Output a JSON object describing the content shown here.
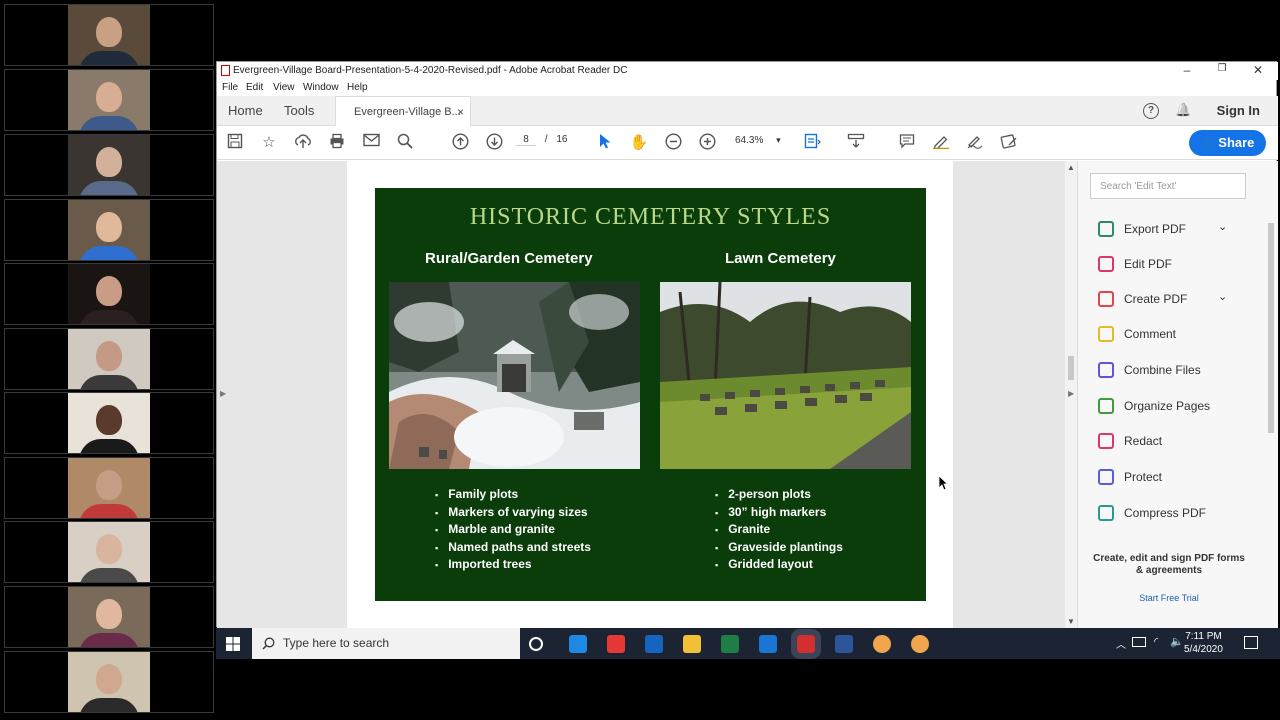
{
  "window": {
    "title": "Evergreen-Village Board-Presentation-5-4-2020-Revised.pdf - Adobe Acrobat Reader DC",
    "minimize": "–",
    "restore": "❐",
    "close": "✕"
  },
  "menu": [
    "File",
    "Edit",
    "View",
    "Window",
    "Help"
  ],
  "tabs": {
    "home": "Home",
    "tools": "Tools",
    "doc": "Evergreen-Village B...",
    "close": "×"
  },
  "header": {
    "help_icon": "?",
    "bell_icon": "🔔",
    "sign_in": "Sign In"
  },
  "toolbar": {
    "current_page": "8",
    "separator": "/",
    "total_pages": "16",
    "zoom": "64.3%",
    "zoom_arrow": "▾",
    "share": "Share"
  },
  "slide": {
    "title": "HISTORIC CEMETERY STYLES",
    "left_heading": "Rural/Garden Cemetery",
    "right_heading": "Lawn Cemetery",
    "left_bullets": [
      "Family plots",
      "Markers of varying sizes",
      "Marble and granite",
      "Named paths and streets",
      "Imported trees"
    ],
    "right_bullets": [
      "2-person plots",
      "30” high markers",
      "Granite",
      "Graveside plantings",
      "Gridded layout"
    ]
  },
  "right_panel": {
    "search_placeholder": "Search 'Edit Text'",
    "tools": [
      {
        "label": "Export PDF",
        "icon": "export-pdf-icon",
        "color": "#2b8a6e",
        "has_chevron": true
      },
      {
        "label": "Edit PDF",
        "icon": "edit-pdf-icon",
        "color": "#d9376e",
        "has_chevron": false
      },
      {
        "label": "Create PDF",
        "icon": "create-pdf-icon",
        "color": "#e0464b",
        "has_chevron": true
      },
      {
        "label": "Comment",
        "icon": "comment-icon",
        "color": "#e8b923",
        "has_chevron": false
      },
      {
        "label": "Combine Files",
        "icon": "combine-files-icon",
        "color": "#6b4fd8",
        "has_chevron": false
      },
      {
        "label": "Organize Pages",
        "icon": "organize-pages-icon",
        "color": "#3e9b3e",
        "has_chevron": false
      },
      {
        "label": "Redact",
        "icon": "redact-icon",
        "color": "#d9376e",
        "has_chevron": false
      },
      {
        "label": "Protect",
        "icon": "protect-icon",
        "color": "#5b5be0",
        "has_chevron": false
      },
      {
        "label": "Compress PDF",
        "icon": "compress-pdf-icon",
        "color": "#2b9a8e",
        "has_chevron": false
      }
    ],
    "chevron": "⌄",
    "promo": "Create, edit and sign PDF forms & agreements",
    "trial": "Start Free Trial"
  },
  "taskbar": {
    "search_placeholder": "Type here to search",
    "time": "7:11 PM",
    "date": "5/4/2020",
    "apps": [
      {
        "icon": "cortana-icon",
        "color": "#ffffff"
      },
      {
        "icon": "edge-icon",
        "color": "#1e88e5"
      },
      {
        "icon": "chrome-icon",
        "color": "#e53935"
      },
      {
        "icon": "outlook-icon",
        "color": "#1565c0"
      },
      {
        "icon": "file-explorer-icon",
        "color": "#f2c037"
      },
      {
        "icon": "excel-icon",
        "color": "#1e7e45"
      },
      {
        "icon": "outlook-2-icon",
        "color": "#1976d2"
      },
      {
        "icon": "acrobat-icon",
        "color": "#d32f2f"
      },
      {
        "icon": "word-icon",
        "color": "#2b579a"
      },
      {
        "icon": "app-orange-1-icon",
        "color": "#f0a44b"
      },
      {
        "icon": "app-orange-2-icon",
        "color": "#f0a44b"
      }
    ]
  },
  "participants": [
    {
      "bg": "#5a4a3a",
      "skin": "#c9a084",
      "shirt": "#1f2a3a"
    },
    {
      "bg": "#8a7a6a",
      "skin": "#d7ad94",
      "shirt": "#3e5a8a"
    },
    {
      "bg": "#3a3530",
      "skin": "#d3b09a",
      "shirt": "#5a6a8a"
    },
    {
      "bg": "#6a5a4a",
      "skin": "#e0b89a",
      "shirt": "#2f6fd0"
    },
    {
      "bg": "#1a1512",
      "skin": "#c99c86",
      "shirt": "#2a2020"
    },
    {
      "bg": "#cfc9c0",
      "skin": "#c49a86",
      "shirt": "#3a3a3a"
    },
    {
      "bg": "#e8e2d8",
      "skin": "#5a3a2a",
      "shirt": "#1a1a1a"
    },
    {
      "bg": "#b08a68",
      "skin": "#c49d84",
      "shirt": "#c03a3a"
    },
    {
      "bg": "#d8d0c4",
      "skin": "#d9b49e",
      "shirt": "#4a4a4a"
    },
    {
      "bg": "#7a6a5a",
      "skin": "#e0b8a0",
      "shirt": "#6a2a4a"
    },
    {
      "bg": "#cfc4b0",
      "skin": "#d0a890",
      "shirt": "#2a2a2a"
    }
  ]
}
